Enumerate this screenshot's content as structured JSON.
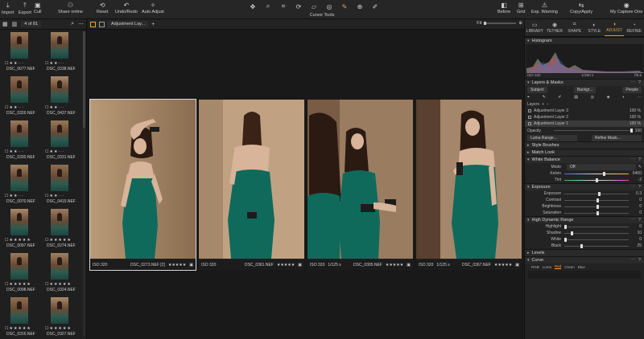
{
  "toolbar": {
    "left": [
      {
        "name": "import-button",
        "label": "Import",
        "icon": "download-icon"
      },
      {
        "name": "export-button",
        "label": "Export",
        "icon": "upload-icon"
      },
      {
        "name": "cull-button",
        "label": "Cull",
        "icon": "cull-icon"
      },
      {
        "name": "share-online-button",
        "label": "Share online",
        "icon": "people-icon"
      },
      {
        "name": "reset-button",
        "label": "Reset",
        "icon": "reset-icon"
      },
      {
        "name": "undo-redo-button",
        "label": "Undo/Redo",
        "icon": "undo-icon"
      },
      {
        "name": "auto-adjust-button",
        "label": "Auto Adjust",
        "icon": "magic-icon"
      }
    ],
    "cursor_tools_label": "Cursor Tools",
    "cursor_tools": [
      {
        "name": "pan-tool-icon",
        "glyph": "✥"
      },
      {
        "name": "loupe-tool-icon",
        "glyph": "⌕"
      },
      {
        "name": "crop-tool-icon",
        "glyph": "⌗"
      },
      {
        "name": "rotate-tool-icon",
        "glyph": "⟳"
      },
      {
        "name": "keystone-tool-icon",
        "glyph": "▱"
      },
      {
        "name": "spot-tool-icon",
        "glyph": "◎"
      },
      {
        "name": "brush-tool-icon",
        "glyph": "✎",
        "active": true
      },
      {
        "name": "picker-tool-icon",
        "glyph": "⊕"
      },
      {
        "name": "annotate-tool-icon",
        "glyph": "✐"
      }
    ],
    "right": [
      {
        "name": "before-button",
        "label": "Before",
        "icon": "before-icon"
      },
      {
        "name": "grid-button",
        "label": "Grid",
        "icon": "grid-icon"
      },
      {
        "name": "exp-warning-button",
        "label": "Exp. Warning",
        "icon": "warning-icon"
      },
      {
        "name": "copy-apply-button",
        "label": "Copy/Apply",
        "icon": "copy-icon"
      },
      {
        "name": "my-capture-one-button",
        "label": "My Capture One",
        "icon": "user-icon"
      }
    ]
  },
  "browser": {
    "count": "4 of 81",
    "thumbnails": [
      {
        "rating": "☐ ★ ★ · · ·",
        "file": "DSC_0077.NEF"
      },
      {
        "rating": "☐ ★ ★ · · ·",
        "file": "DSC_0338.NEF"
      },
      {
        "rating": "☐ ★ ★ · · ·",
        "file": "DSC_0326.NEF"
      },
      {
        "rating": "☐ ★ ★ · · ·",
        "file": "DSC_0437.NEF"
      },
      {
        "rating": "☐ ★ ★ · · ·",
        "file": "DSC_0330.NEF"
      },
      {
        "rating": "☐ ★ ★ · · ·",
        "file": "DSC_0331.NEF"
      },
      {
        "rating": "☐ ★ ★ · · ·",
        "file": "DSC_0070.NEF"
      },
      {
        "rating": "☐ ★ ★ · · ·",
        "file": "DSC_0415.NEF"
      },
      {
        "rating": "☐ ★ ★ ★ ★ ★",
        "file": "DSC_0097.NEF"
      },
      {
        "rating": "☐ ★ ★ ★ ★ ★",
        "file": "DSC_0274.NEF"
      },
      {
        "rating": "☐ ★ ★ ★ ★ ★",
        "file": "DSC_0098.NEF"
      },
      {
        "rating": "☐ ★ ★ ★ ★ ★",
        "file": "DSC_0324.NEF"
      },
      {
        "rating": "☐ ★ ★ ★ ★ ★",
        "file": "DSC_0316.NEF"
      },
      {
        "rating": "☐ ★ ★ ★ ★ ★",
        "file": "DSC_0327.NEF"
      }
    ]
  },
  "viewer": {
    "layer_select": "Adjustment Lay...",
    "add": "+",
    "fit_label": "Fit",
    "photos": [
      {
        "iso": "ISO 320",
        "shutter": "",
        "file": "DSC_0273.NEF [2]",
        "rating": "★★★★★",
        "selected": true
      },
      {
        "iso": "ISO 320",
        "shutter": "",
        "file": "DSC_0361.NEF",
        "rating": "★★★★★",
        "selected": false
      },
      {
        "iso": "ISO 320",
        "shutter": "1/125 s",
        "file": "DSC_0305.NEF",
        "rating": "★★★★★",
        "selected": false
      },
      {
        "iso": "ISO 320",
        "shutter": "1/125 s",
        "file": "DSC_0367.NEF",
        "rating": "★★★★★",
        "selected": false
      }
    ]
  },
  "panel": {
    "tabs": [
      {
        "label": "LIBRARY",
        "icon": "library-icon",
        "active": false
      },
      {
        "label": "TETHER",
        "icon": "camera-icon",
        "active": false
      },
      {
        "label": "SHAPE",
        "icon": "shape-icon",
        "active": false
      },
      {
        "label": "STYLE",
        "icon": "palette-icon",
        "active": false
      },
      {
        "label": "ADJUST",
        "icon": "adjust-icon",
        "active": true
      },
      {
        "label": "REFINE",
        "icon": "refine-icon",
        "active": false
      }
    ],
    "histogram": {
      "title": "Histogram",
      "iso": "ISO 320",
      "shutter": "1/250 s",
      "aperture": "f/5.6"
    },
    "layers_masks": {
      "title": "Layers & Masks",
      "subject": "Subject",
      "background": "Backgr...",
      "people": "People",
      "layers_label": "Layers",
      "layers": [
        {
          "name": "Adjustment Layer 3",
          "pct": "100 %",
          "selected": false
        },
        {
          "name": "Adjustment Layer 2",
          "pct": "100 %",
          "selected": false
        },
        {
          "name": "Adjustment Layer 1",
          "pct": "100 %",
          "selected": true
        }
      ],
      "opacity_label": "Opacity",
      "opacity_value": "100",
      "luma_range": "Luma Range...",
      "refine_mask": "Refine Mask..."
    },
    "style_brushes": "Style Brushes",
    "match_look": "Match Look",
    "white_balance": {
      "title": "White Balance",
      "mode_label": "Mode",
      "mode_value": "Off",
      "kelvin_label": "Kelvin",
      "kelvin_value": "6400",
      "tint_label": "Tint",
      "tint_value": "-2"
    },
    "exposure": {
      "title": "Exposure",
      "sliders": [
        {
          "label": "Exposure",
          "value": "0.3",
          "pos": 0.53
        },
        {
          "label": "Contrast",
          "value": "0",
          "pos": 0.5
        },
        {
          "label": "Brightness",
          "value": "0",
          "pos": 0.5
        },
        {
          "label": "Saturation",
          "value": "0",
          "pos": 0.5
        }
      ]
    },
    "hdr": {
      "title": "High Dynamic Range",
      "sliders": [
        {
          "label": "Highlight",
          "value": "0",
          "pos": 0.0
        },
        {
          "label": "Shadow",
          "value": "10",
          "pos": 0.1
        },
        {
          "label": "White",
          "value": "0",
          "pos": 0.0
        },
        {
          "label": "Black",
          "value": "25",
          "pos": 0.25
        }
      ]
    },
    "levels": "Levels",
    "curve": {
      "title": "Curve",
      "tabs": [
        {
          "label": "RGB",
          "active": false
        },
        {
          "label": "Luma",
          "active": false
        },
        {
          "label": "Red",
          "active": true
        },
        {
          "label": "Green",
          "active": false
        },
        {
          "label": "Blue",
          "active": false
        }
      ]
    }
  }
}
